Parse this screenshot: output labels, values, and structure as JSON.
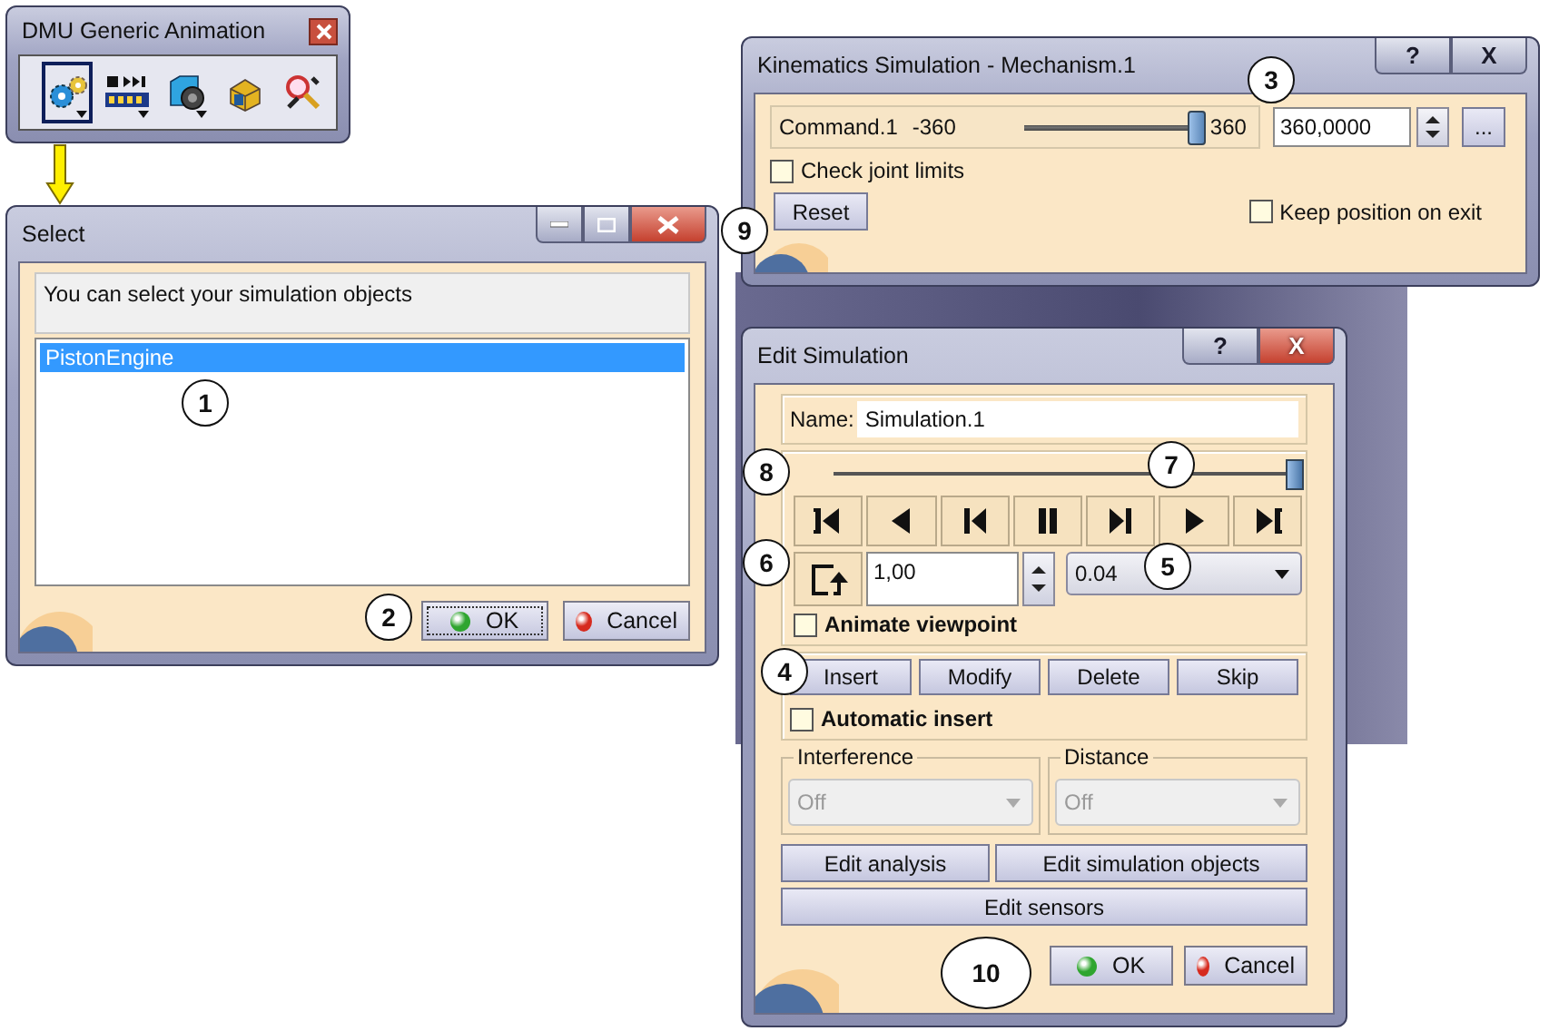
{
  "toolbar": {
    "title": "DMU Generic Animation",
    "tools": [
      {
        "kind": "gear",
        "selected": true,
        "dropdown": true
      },
      {
        "kind": "film",
        "selected": false,
        "dropdown": true
      },
      {
        "kind": "camera",
        "selected": false,
        "dropdown": true
      },
      {
        "kind": "box",
        "selected": false,
        "dropdown": false
      },
      {
        "kind": "magnifier",
        "selected": false,
        "dropdown": false
      }
    ]
  },
  "select_dialog": {
    "title": "Select",
    "message": "You can select your simulation objects",
    "items": [
      {
        "label": "PistonEngine",
        "selected": true
      }
    ],
    "buttons": [
      {
        "label": "OK",
        "kind": "ok"
      },
      {
        "label": "Cancel",
        "kind": "cancel"
      }
    ]
  },
  "kinematics_dialog": {
    "title": "Kinematics Simulation - Mechanism.1",
    "title_buttons": [
      {
        "label": "?",
        "highlighted": false
      },
      {
        "label": "X",
        "highlighted": false
      }
    ],
    "command": {
      "name": "Command.1",
      "min": "-360",
      "max": "360",
      "level": 1,
      "value": "360,0000",
      "more": "..."
    },
    "check_joint_limits": {
      "label": "Check joint limits",
      "checked": false
    },
    "reset": "Reset",
    "keep_position": {
      "label": "Keep position on exit",
      "checked": false
    }
  },
  "edit_simulation": {
    "title": "Edit Simulation",
    "title_buttons": [
      {
        "label": "?",
        "highlighted": false
      },
      {
        "label": "X",
        "highlighted": true
      }
    ],
    "name_label": "Name:",
    "name_value": "Simulation.1",
    "level": 1,
    "player_buttons": [
      {
        "kind": "first"
      },
      {
        "kind": "prev"
      },
      {
        "kind": "step-back"
      },
      {
        "kind": "pause"
      },
      {
        "kind": "step-forward"
      },
      {
        "kind": "play"
      },
      {
        "kind": "last"
      }
    ],
    "step_value": "1,00",
    "sample": "0.04",
    "animate_viewpoint": {
      "label": "Animate viewpoint",
      "checked": false
    },
    "actions": [
      "Insert",
      "Modify",
      "Delete",
      "Skip"
    ],
    "automatic_insert": {
      "label": "Automatic insert",
      "checked": false
    },
    "interference": {
      "label": "Interference",
      "value": "Off",
      "disabled": true
    },
    "distance": {
      "label": "Distance",
      "value": "Off",
      "disabled": true
    },
    "edit_buttons": [
      "Edit analysis",
      "Edit simulation objects",
      "Edit sensors"
    ],
    "buttons": [
      {
        "label": "OK",
        "kind": "ok"
      },
      {
        "label": "Cancel",
        "kind": "cancel"
      }
    ]
  },
  "callouts": [
    "1",
    "2",
    "3",
    "4",
    "5",
    "6",
    "7",
    "8",
    "9",
    "10"
  ]
}
